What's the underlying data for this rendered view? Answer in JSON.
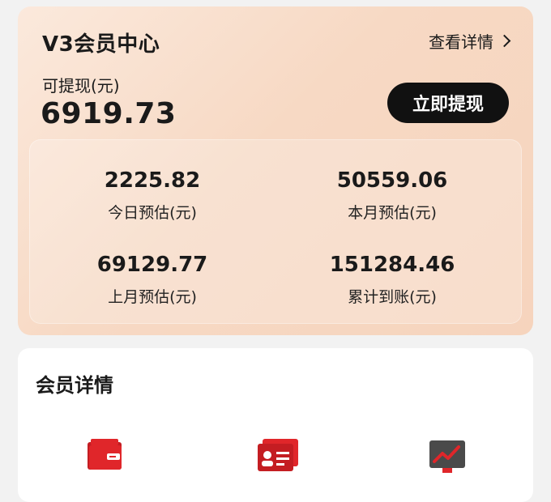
{
  "header": {
    "title": "V3会员中心",
    "detail_link": "查看详情"
  },
  "withdraw": {
    "label": "可提现(元)",
    "amount": "6919.73",
    "button": "立即提现"
  },
  "stats": [
    {
      "value": "2225.82",
      "label": "今日预估(元)"
    },
    {
      "value": "50559.06",
      "label": "本月预估(元)"
    },
    {
      "value": "69129.77",
      "label": "上月预估(元)"
    },
    {
      "value": "151284.46",
      "label": "累计到账(元)"
    }
  ],
  "member_details": {
    "title": "会员详情",
    "icons": [
      "wallet-icon",
      "id-card-icon",
      "trend-chart-icon"
    ]
  },
  "colors": {
    "accent_red": "#e0262a",
    "button_black": "#111111"
  }
}
